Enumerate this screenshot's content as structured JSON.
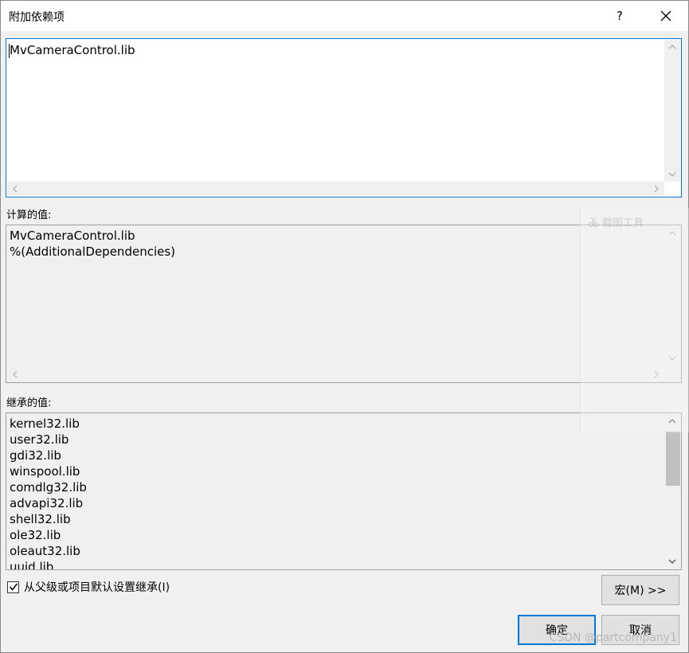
{
  "window": {
    "title": "附加依赖项",
    "help_label": "?"
  },
  "edit": {
    "value": "MvCameraControl.lib"
  },
  "evaluated": {
    "label": "计算的值:",
    "lines": [
      "MvCameraControl.lib",
      "%(AdditionalDependencies)"
    ]
  },
  "inherited": {
    "label": "继承的值:",
    "lines": [
      "kernel32.lib",
      "user32.lib",
      "gdi32.lib",
      "winspool.lib",
      "comdlg32.lib",
      "advapi32.lib",
      "shell32.lib",
      "ole32.lib",
      "oleaut32.lib",
      "uuid.lib"
    ],
    "scroll_position": 0.1
  },
  "inherit_checkbox": {
    "label": "从父级或项目默认设置继承(I)",
    "checked": true
  },
  "buttons": {
    "macros": "宏(M) >>",
    "ok": "确定",
    "cancel": "取消"
  },
  "overlay": {
    "ghost_tool_label": "截图工具",
    "watermark": "CSDN @partcompany1"
  },
  "colors": {
    "accent": "#0078d7",
    "dialog_bg": "#f0f0f0"
  },
  "icons": {
    "close": "close-icon",
    "checkmark": "checkmark-icon"
  }
}
